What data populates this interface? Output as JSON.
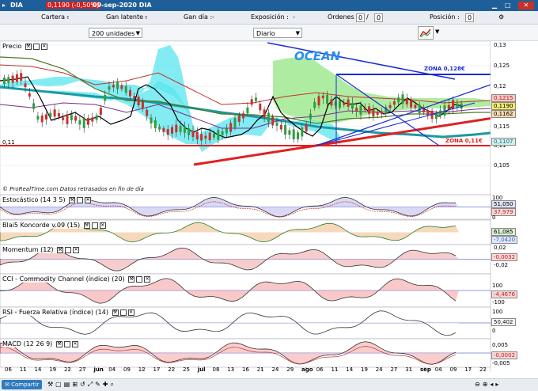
{
  "titlebar": {
    "symbol": "DIA",
    "price": "0,1190 (-0,50%)",
    "date_symbol": "09-sep-2020 DIA"
  },
  "positions": {
    "cartera_label": "Cartera :",
    "cartera_value": "-",
    "gan_latente_label": "Gan latente :",
    "gan_latente_value": "-",
    "gan_dia_label": "Gan día :",
    "gan_dia_value": "-",
    "exposicion_label": "Exposición :",
    "exposicion_value": "-",
    "ordenes_label": "Órdenes :",
    "ordenes_value": "0",
    "ordenes_count": "0",
    "posicion_label": "Posición :",
    "posicion_value": "0"
  },
  "toolbar": {
    "units": "200 unidades",
    "period": "Diario"
  },
  "price_panel": {
    "label": "Precio",
    "watermark": "© ProRealTime.com Datos retrasados en fin de día",
    "annotations": {
      "ocean": "OCEAN",
      "zona_high": "ZONA 0,128€",
      "zona_low": "ZONA 0,11€"
    },
    "left_marker": "0,11",
    "y_ticks": [
      "0,13",
      "0,125",
      "0,12",
      "0,115",
      "0,11",
      "0,105"
    ],
    "value_boxes": [
      "0,1215",
      "0,1190",
      "0,1162",
      "0,1107"
    ]
  },
  "panels": [
    {
      "label": "Estocástico (14 3 5)",
      "ticks": [
        "100",
        "0"
      ],
      "values": [
        "51,050",
        "37,979"
      ]
    },
    {
      "label": "Blai5 Koncorde v.09 (15)",
      "ticks": [],
      "values": [
        "61,085",
        "-7,0420"
      ]
    },
    {
      "label": "Momentum (12)",
      "ticks": [
        "0,02",
        "0",
        "-0,02"
      ],
      "values": [
        "-0,0032"
      ]
    },
    {
      "label": "CCI - Commodity Channel (índice) (20)",
      "ticks": [
        "100",
        "-100"
      ],
      "values": [
        "-4,4676"
      ]
    },
    {
      "label": "RSI - Fuerza Relativa (índice) (14)",
      "ticks": [
        "100",
        "0"
      ],
      "values": [
        "50,402"
      ]
    },
    {
      "label": "MACD (12 26 9)",
      "ticks": [
        "0,005",
        "0",
        "-0,005"
      ],
      "values": [
        "-0,0002"
      ]
    }
  ],
  "x_axis": [
    "06",
    "11",
    "14",
    "19",
    "22",
    "27",
    "jun",
    "04",
    "09",
    "12",
    "17",
    "22",
    "25",
    "jul",
    "08",
    "13",
    "16",
    "21",
    "24",
    "29",
    "ago",
    "06",
    "11",
    "14",
    "19",
    "24",
    "27",
    "31",
    "sep",
    "04",
    "09",
    "17",
    "22"
  ],
  "bottombar": {
    "share": "Compartir"
  },
  "colors": {
    "cloud": "#5ae6ee",
    "cloud_green": "#9ae88a",
    "support": "#e02020",
    "trend": "#1d2bd6",
    "teal_ma": "#1b9aa0"
  }
}
